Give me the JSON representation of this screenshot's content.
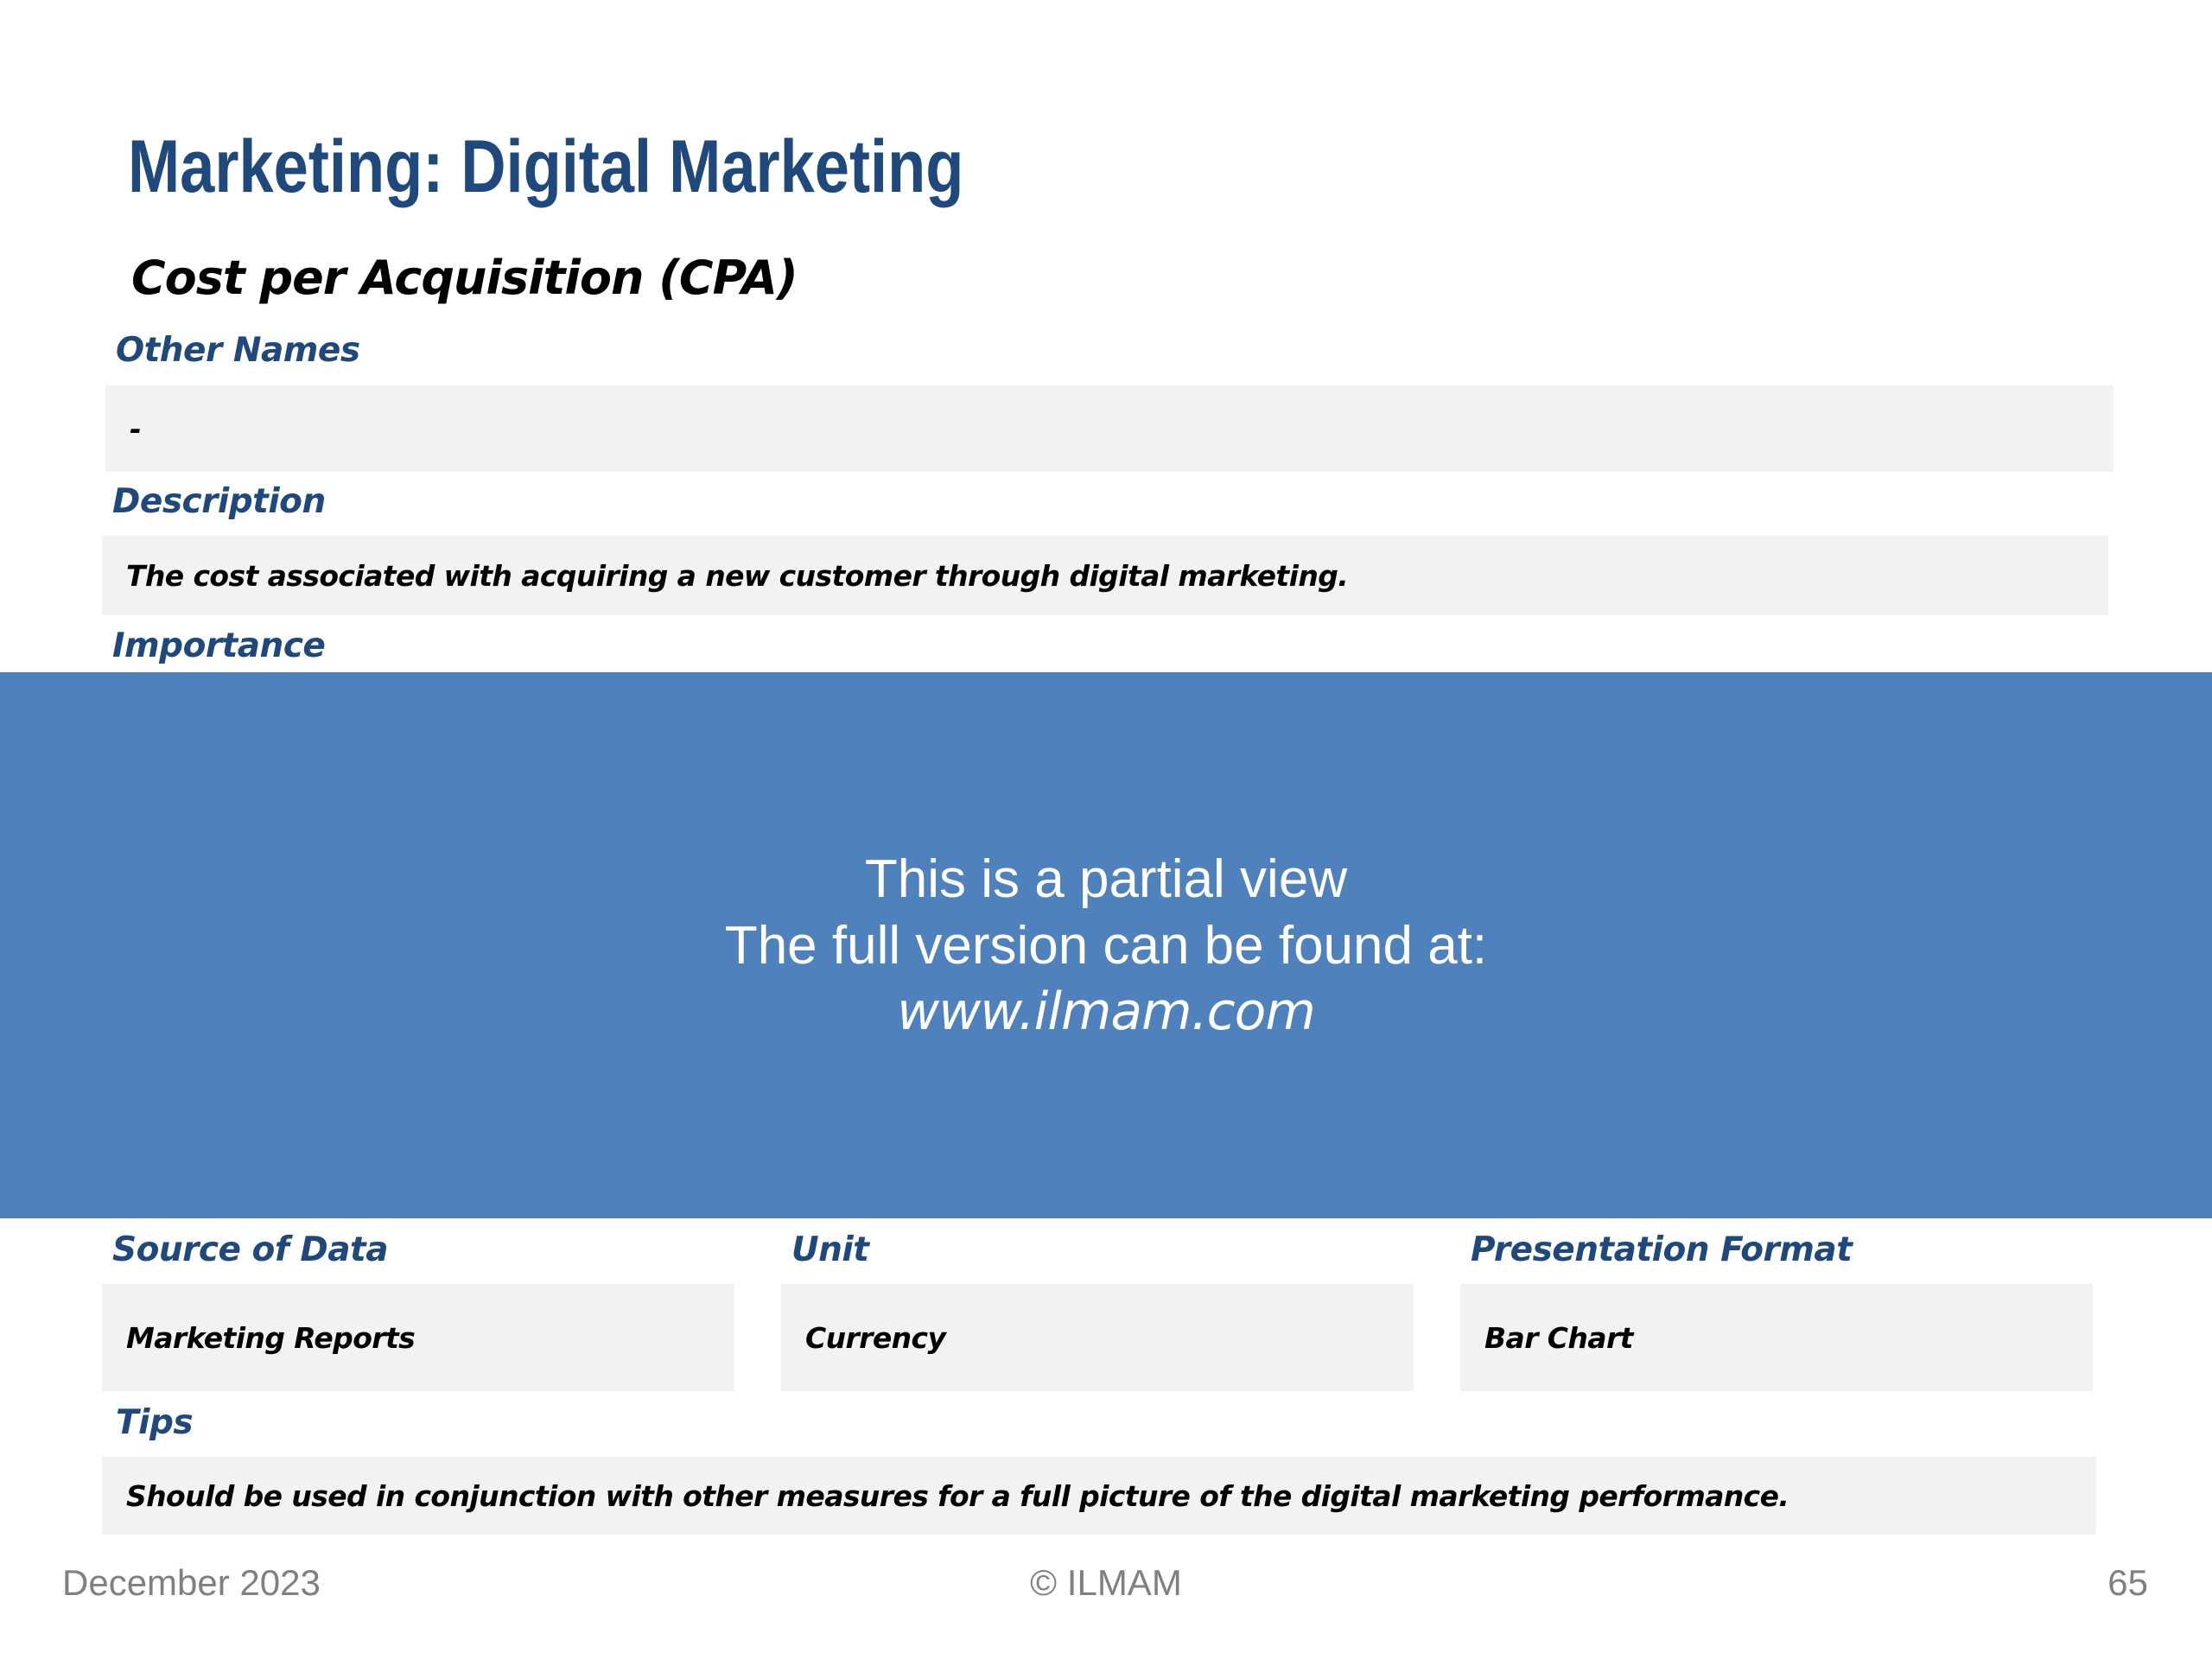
{
  "page": {
    "title": "Marketing: Digital Marketing",
    "kpi_name": "Cost per Acquisition (CPA)"
  },
  "fields": {
    "other_names": {
      "label": "Other Names",
      "value": "-"
    },
    "description": {
      "label": "Description",
      "value": "The cost associated with acquiring a new customer through digital marketing."
    },
    "importance": {
      "label": "Importance"
    },
    "source_of_data": {
      "label": "Source of Data",
      "value": "Marketing Reports"
    },
    "unit": {
      "label": "Unit",
      "value": "Currency"
    },
    "presentation_format": {
      "label": "Presentation Format",
      "value": "Bar Chart"
    },
    "tips": {
      "label": "Tips",
      "value": "Should be used in conjunction with other measures for a full picture of the digital marketing performance."
    }
  },
  "overlay": {
    "line1": "This is a partial view",
    "line2": "The full version can be found at:",
    "url": "www.ilmam.com"
  },
  "footer": {
    "date": "December 2023",
    "copyright": "© ILMAM",
    "page_number": "65"
  },
  "colors": {
    "title": "#1F497D",
    "label": "#1F497D",
    "box_background": "#F2F2F2",
    "overlay_background": "#4F81BD",
    "footer_text": "#808080"
  }
}
